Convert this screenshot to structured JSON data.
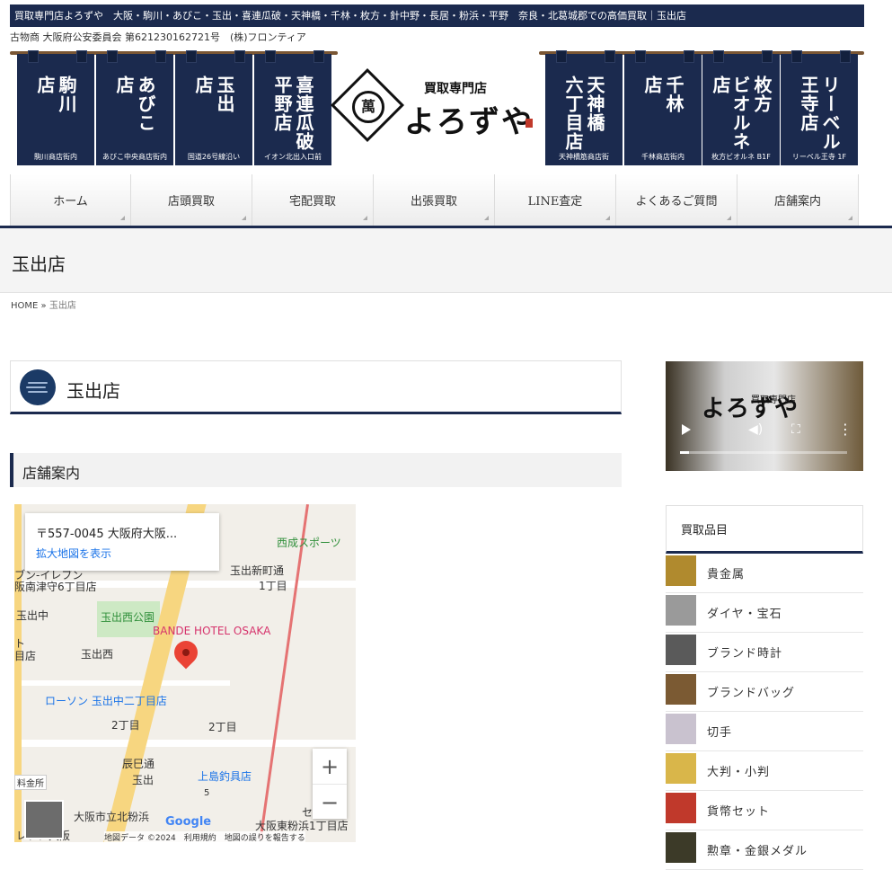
{
  "top_bar": {
    "text": "買取専門店よろずや　大阪・駒川・あびこ・玉出・喜連瓜破・天神橋・千林・枚方・針中野・長居・粉浜・平野　奈良・北葛城郡での高価買取｜玉出店"
  },
  "license_line": "古物商 大阪府公安委員会 第621230162721号　(株)フロンティア",
  "noren_left": [
    {
      "cols": [
        "駒川",
        "店"
      ],
      "sub": "駒川商店街内"
    },
    {
      "cols": [
        "あびこ",
        "店"
      ],
      "sub": "あびこ中央商店街内"
    },
    {
      "cols": [
        "玉出",
        "店"
      ],
      "sub": "国道26号線沿い"
    },
    {
      "cols": [
        "喜連瓜破",
        "平野店"
      ],
      "sub": "イオン北出入口前"
    }
  ],
  "noren_right": [
    {
      "cols": [
        "天神橋",
        "六丁目店"
      ],
      "sub": "天神橋筋商店街"
    },
    {
      "cols": [
        "千林",
        "店"
      ],
      "sub": "千林商店街内"
    },
    {
      "cols": [
        "枚方",
        "ビオルネ店"
      ],
      "sub": "枚方ビオルネ B1F"
    },
    {
      "cols": [
        "リーベル",
        "王寺店"
      ],
      "sub": "リーベル王寺 1F"
    }
  ],
  "logo": {
    "sub": "買取専門店",
    "name": "よろずや",
    "mark": "萬"
  },
  "nav": [
    "ホーム",
    "店頭買取",
    "宅配買取",
    "出張買取",
    "LINE査定",
    "よくあるご質問",
    "店舗案内"
  ],
  "page_title": "玉出店",
  "breadcrumb": {
    "home": "HOME",
    "sep": "»",
    "current": "玉出店"
  },
  "post_title": "玉出店",
  "section_title": "店舗案内",
  "map": {
    "address": "〒557-0045 大阪府大阪...",
    "enlarge_link": "拡大地図を表示",
    "labels": {
      "seinari": "西成スポーツ",
      "tamade_shinmachi": "玉出新町通",
      "chome1": "1丁目",
      "seven": "ブン-イレブン",
      "minami": "阪南津守6丁目店",
      "tamade_naka": "玉出中",
      "tamade_nishi_park": "玉出西公園",
      "bande": "BANDE HOTEL OSAKA",
      "to": "ト",
      "me_ten": "目店",
      "tamade_nishi": "玉出西",
      "lawson": "ローソン 玉出中二丁目店",
      "chome2a": "2丁目",
      "chome2b": "2丁目",
      "tatsumi": "辰巳通",
      "tamade": "玉出",
      "ueshima": "上島釣具店",
      "kitakohama": "大阪市立北粉浜",
      "seven_b": "セブン-",
      "higashikohama": "大阪東粉浜1丁目店",
      "osaka": "レブン大阪",
      "toll": "料金所",
      "route": "5"
    },
    "google": "Google",
    "footer": "地図データ ©2024　利用規約　地図の誤りを報告する",
    "zoom_in": "+",
    "zoom_out": "−"
  },
  "video": {
    "sub": "買取専門店",
    "name": "よろずや"
  },
  "sidebar": {
    "heading": "買取品目",
    "items": [
      {
        "label": "貴金属",
        "color": "#b08a2e"
      },
      {
        "label": "ダイヤ・宝石",
        "color": "#9a9a9a"
      },
      {
        "label": "ブランド時計",
        "color": "#5a5a5a"
      },
      {
        "label": "ブランドバッグ",
        "color": "#7b5a33"
      },
      {
        "label": "切手",
        "color": "#c9c2cf"
      },
      {
        "label": "大判・小判",
        "color": "#d9b64a"
      },
      {
        "label": "貨幣セット",
        "color": "#c0392b"
      },
      {
        "label": "勲章・金銀メダル",
        "color": "#3c3a28"
      }
    ]
  }
}
